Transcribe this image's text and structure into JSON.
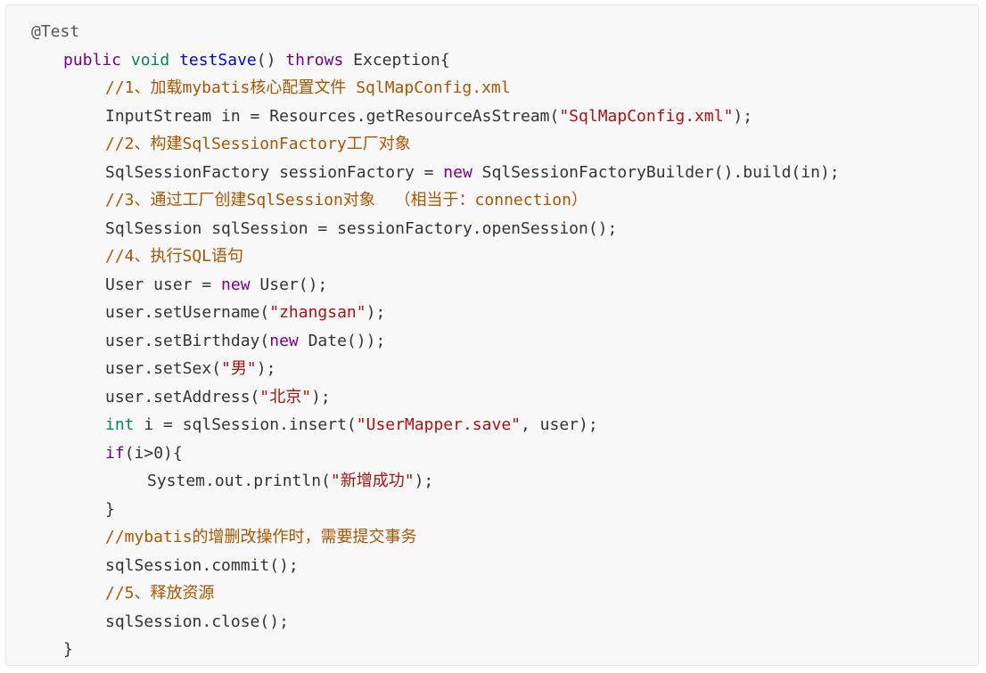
{
  "code_block": {
    "language": "java",
    "colors": {
      "background": "#f8f8f8",
      "plain": "#333333",
      "annotation": "#555555",
      "keyword": "#770088",
      "type": "#008855",
      "function": "#0000ff",
      "string": "#aa1111",
      "comment": "#aa5500"
    },
    "lines": [
      {
        "indent": 0,
        "tokens": [
          {
            "t": "annotation",
            "v": "@Test"
          }
        ]
      },
      {
        "indent": 1,
        "tokens": [
          {
            "t": "keyword",
            "v": "public"
          },
          {
            "t": "plain",
            "v": " "
          },
          {
            "t": "type",
            "v": "void"
          },
          {
            "t": "plain",
            "v": " "
          },
          {
            "t": "func",
            "v": "testSave"
          },
          {
            "t": "plain",
            "v": "() "
          },
          {
            "t": "keyword",
            "v": "throws"
          },
          {
            "t": "plain",
            "v": " Exception{"
          }
        ]
      },
      {
        "indent": 2,
        "tokens": [
          {
            "t": "comment",
            "v": "//1、加载mybatis核心配置文件 SqlMapConfig.xml"
          }
        ]
      },
      {
        "indent": 2,
        "tokens": [
          {
            "t": "plain",
            "v": "InputStream in = Resources.getResourceAsStream("
          },
          {
            "t": "string",
            "v": "\"SqlMapConfig.xml\""
          },
          {
            "t": "plain",
            "v": ");"
          }
        ]
      },
      {
        "indent": 2,
        "tokens": [
          {
            "t": "comment",
            "v": "//2、构建SqlSessionFactory工厂对象"
          }
        ]
      },
      {
        "indent": 2,
        "tokens": [
          {
            "t": "plain",
            "v": "SqlSessionFactory sessionFactory = "
          },
          {
            "t": "keyword",
            "v": "new"
          },
          {
            "t": "plain",
            "v": " SqlSessionFactoryBuilder().build(in);"
          }
        ]
      },
      {
        "indent": 2,
        "tokens": [
          {
            "t": "comment",
            "v": "//3、通过工厂创建SqlSession对象  （相当于：connection）"
          }
        ]
      },
      {
        "indent": 2,
        "tokens": [
          {
            "t": "plain",
            "v": "SqlSession sqlSession = sessionFactory.openSession();"
          }
        ]
      },
      {
        "indent": 2,
        "tokens": [
          {
            "t": "comment",
            "v": "//4、执行SQL语句"
          }
        ]
      },
      {
        "indent": 2,
        "tokens": [
          {
            "t": "plain",
            "v": "User user = "
          },
          {
            "t": "keyword",
            "v": "new"
          },
          {
            "t": "plain",
            "v": " User();"
          }
        ]
      },
      {
        "indent": 2,
        "tokens": [
          {
            "t": "plain",
            "v": "user.setUsername("
          },
          {
            "t": "string",
            "v": "\"zhangsan\""
          },
          {
            "t": "plain",
            "v": ");"
          }
        ]
      },
      {
        "indent": 2,
        "tokens": [
          {
            "t": "plain",
            "v": "user.setBirthday("
          },
          {
            "t": "keyword",
            "v": "new"
          },
          {
            "t": "plain",
            "v": " Date());"
          }
        ]
      },
      {
        "indent": 2,
        "tokens": [
          {
            "t": "plain",
            "v": "user.setSex("
          },
          {
            "t": "string",
            "v": "\"男\""
          },
          {
            "t": "plain",
            "v": ");"
          }
        ]
      },
      {
        "indent": 2,
        "tokens": [
          {
            "t": "plain",
            "v": "user.setAddress("
          },
          {
            "t": "string",
            "v": "\"北京\""
          },
          {
            "t": "plain",
            "v": ");"
          }
        ]
      },
      {
        "indent": 2,
        "tokens": [
          {
            "t": "type",
            "v": "int"
          },
          {
            "t": "plain",
            "v": " i = sqlSession.insert("
          },
          {
            "t": "string",
            "v": "\"UserMapper.save\""
          },
          {
            "t": "plain",
            "v": ", user);"
          }
        ]
      },
      {
        "indent": 2,
        "tokens": [
          {
            "t": "keyword",
            "v": "if"
          },
          {
            "t": "plain",
            "v": "(i>0){"
          }
        ]
      },
      {
        "indent": 3,
        "tokens": [
          {
            "t": "plain",
            "v": "System.out.println("
          },
          {
            "t": "string",
            "v": "\"新增成功\""
          },
          {
            "t": "plain",
            "v": ");"
          }
        ]
      },
      {
        "indent": 2,
        "tokens": [
          {
            "t": "plain",
            "v": "}"
          }
        ]
      },
      {
        "indent": 2,
        "tokens": [
          {
            "t": "comment",
            "v": "//mybatis的增删改操作时，需要提交事务"
          }
        ]
      },
      {
        "indent": 2,
        "tokens": [
          {
            "t": "plain",
            "v": "sqlSession.commit();"
          }
        ]
      },
      {
        "indent": 2,
        "tokens": [
          {
            "t": "comment",
            "v": "//5、释放资源"
          }
        ]
      },
      {
        "indent": 2,
        "tokens": [
          {
            "t": "plain",
            "v": "sqlSession.close();"
          }
        ]
      },
      {
        "indent": 1,
        "tokens": [
          {
            "t": "plain",
            "v": "}"
          }
        ]
      }
    ]
  }
}
